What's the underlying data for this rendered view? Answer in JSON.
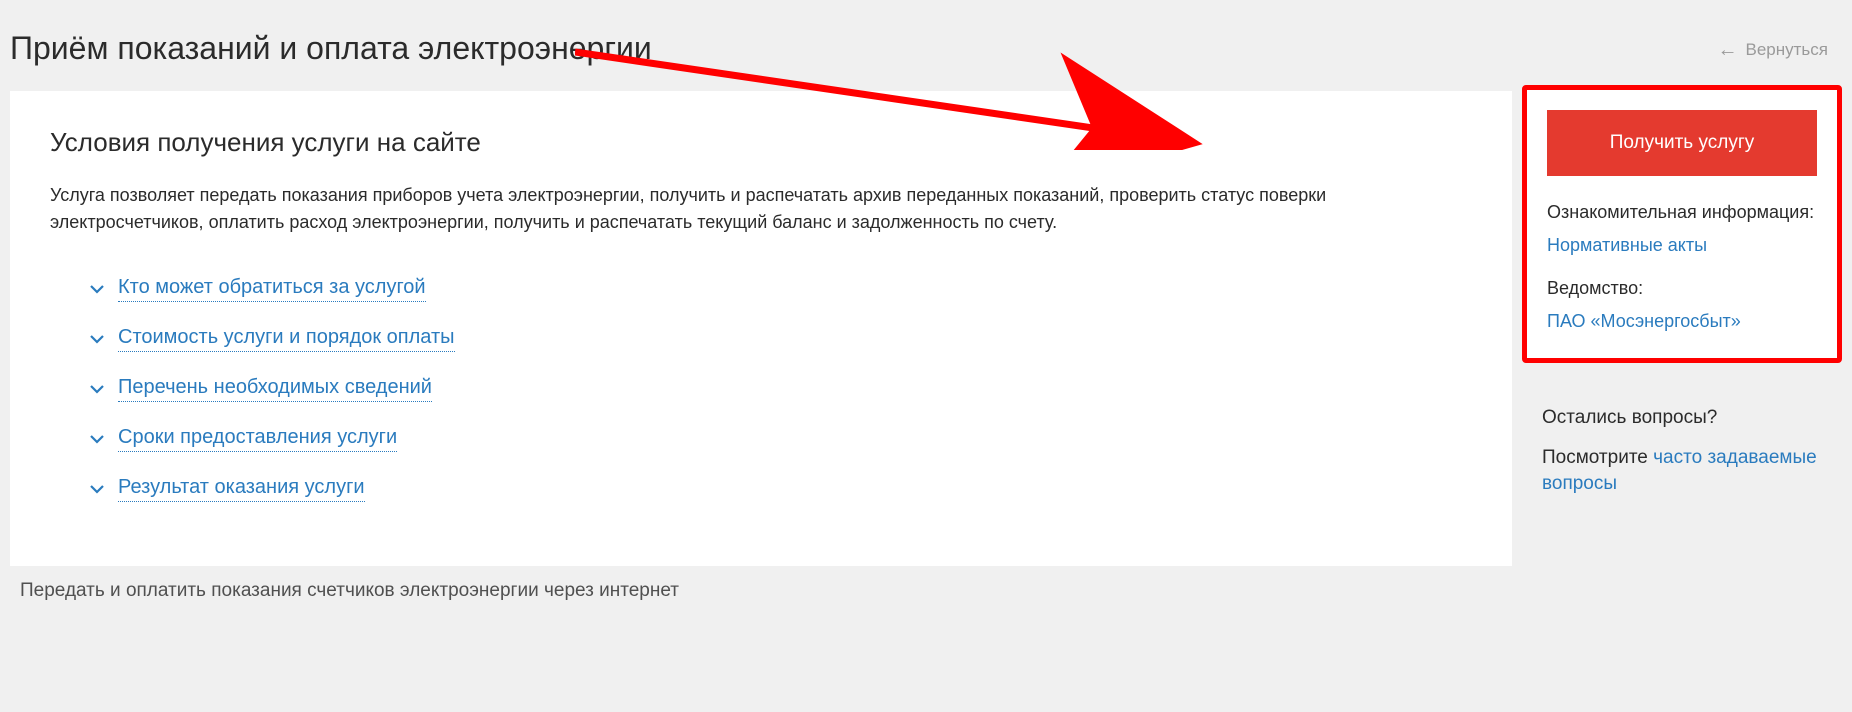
{
  "header": {
    "page_title": "Приём показаний и оплата электроэнергии",
    "back_label": "Вернуться"
  },
  "main": {
    "section_title": "Условия получения услуги на сайте",
    "intro": "Услуга позволяет передать показания приборов учета электроэнергии, получить и распечатать архив переданных показаний, проверить статус поверки электросчетчиков, оплатить расход электроэнергии, получить и распечатать текущий баланс и задолженность по счету.",
    "accordion": [
      "Кто может обратиться за услугой",
      "Стоимость услуги и порядок оплаты",
      "Перечень необходимых сведений",
      "Сроки предоставления услуги",
      "Результат оказания услуги"
    ]
  },
  "sidebar": {
    "cta_label": "Получить услугу",
    "info_label": "Ознакомительная информация:",
    "info_link": "Нормативные акты",
    "dept_label": "Ведомство:",
    "dept_link": "ПАО «Мосэнергосбыт»"
  },
  "questions": {
    "title": "Остались вопросы?",
    "prefix": "Посмотрите ",
    "link": "часто задаваемые вопросы"
  },
  "caption": "Передать и оплатить показания счетчиков электроэнергии через интернет",
  "colors": {
    "accent_red": "#e43a2f",
    "highlight_border": "#ff0000",
    "link_blue": "#2a7bbe"
  }
}
